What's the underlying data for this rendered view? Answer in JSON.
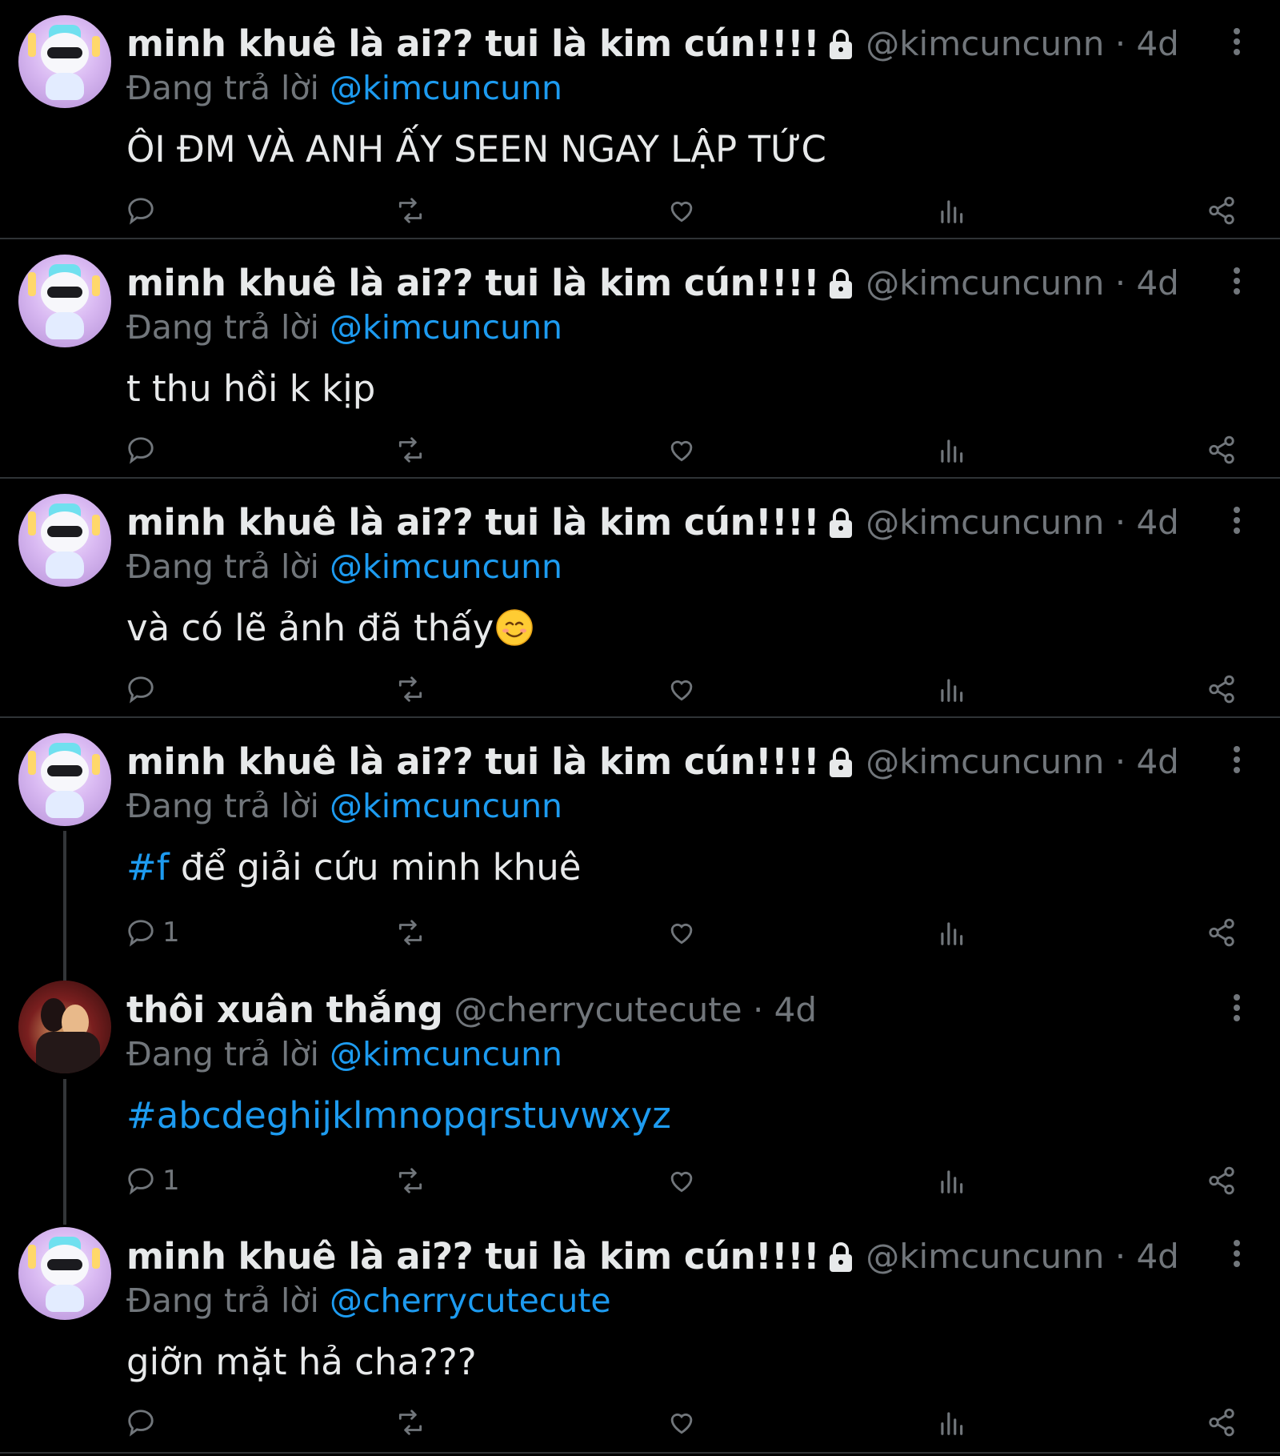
{
  "colors": {
    "background": "#000000",
    "primary_text": "#e7e9ea",
    "secondary_text": "#71767b",
    "accent_link": "#1d9bf0",
    "divider": "#2f3336"
  },
  "icons": {
    "reply": "reply-icon",
    "retweet": "retweet-icon",
    "like": "heart-icon",
    "views": "views-icon",
    "share": "share-icon",
    "more": "more-icon",
    "lock": "lock-icon"
  },
  "tweets": [
    {
      "display_name": "minh khuê là ai?? tui là kim cún!!!!",
      "handle_meta": "@kimcuncunn · 4d",
      "replying_prefix": "Đang trả lời",
      "replying_to": "@kimcuncunn",
      "text": "ÔI ĐM VÀ ANH ẤY SEEN NGAY LẬP TỨC",
      "reply_count": ""
    },
    {
      "display_name": "minh khuê là ai?? tui là kim cún!!!!",
      "handle_meta": "@kimcuncunn · 4d",
      "replying_prefix": "Đang trả lời",
      "replying_to": "@kimcuncunn",
      "text": "t thu hồi k kịp",
      "reply_count": ""
    },
    {
      "display_name": "minh khuê là ai?? tui là kim cún!!!!",
      "handle_meta": "@kimcuncunn · 4d",
      "replying_prefix": "Đang trả lời",
      "replying_to": "@kimcuncunn",
      "text": "và có lẽ ảnh đã thấy",
      "reply_count": ""
    },
    {
      "display_name": "minh khuê là ai?? tui là kim cún!!!!",
      "handle_meta": "@kimcuncunn · 4d",
      "replying_prefix": "Đang trả lời",
      "replying_to": "@kimcuncunn",
      "hashtag": "#f",
      "text": " để giải cứu minh khuê",
      "reply_count": "1"
    },
    {
      "display_name": "thôi xuân thắng",
      "handle_meta": "@cherrycutecute · 4d",
      "replying_prefix": "Đang trả lời",
      "replying_to": "@kimcuncunn",
      "hashtag": "#abcdeghijklmnopqrstuvwxyz",
      "text": "",
      "reply_count": "1"
    },
    {
      "display_name": "minh khuê là ai?? tui là kim cún!!!!",
      "handle_meta": "@kimcuncunn · 4d",
      "replying_prefix": "Đang trả lời",
      "replying_to": "@cherrycutecute",
      "text": "giỡn mặt hả cha???",
      "reply_count": ""
    }
  ]
}
